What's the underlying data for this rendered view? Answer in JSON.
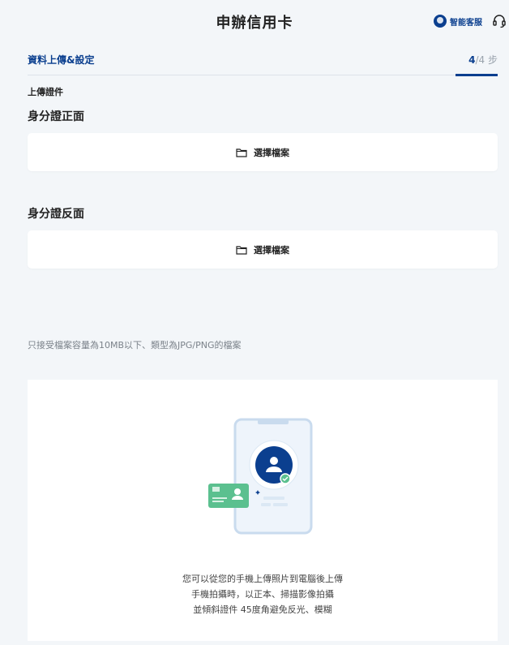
{
  "header": {
    "title": "申辦信用卡",
    "customer_service_label": "智能客服",
    "customer_service_icon": "chat-bot-icon",
    "support_icon": "headset-icon"
  },
  "step": {
    "name": "資料上傳&設定",
    "current": "4",
    "total": "/4 步"
  },
  "upload": {
    "section_label": "上傳證件",
    "front_title": "身分證正面",
    "back_title": "身分證反面",
    "choose_file_label": "選擇檔案",
    "note": "只接受檔案容量為10MB以下、類型為JPG/PNG的檔案"
  },
  "promo": {
    "lines": [
      "您可以從您的手機上傳照片到電腦後上傳",
      "手機拍攝時，以正本、掃描影像拍攝",
      "並傾斜證件 45度角避免反光、模糊"
    ]
  },
  "colors": {
    "brand": "#0b3f8f",
    "card_green": "#5bc08f",
    "page_bg": "#f3f6f9"
  }
}
